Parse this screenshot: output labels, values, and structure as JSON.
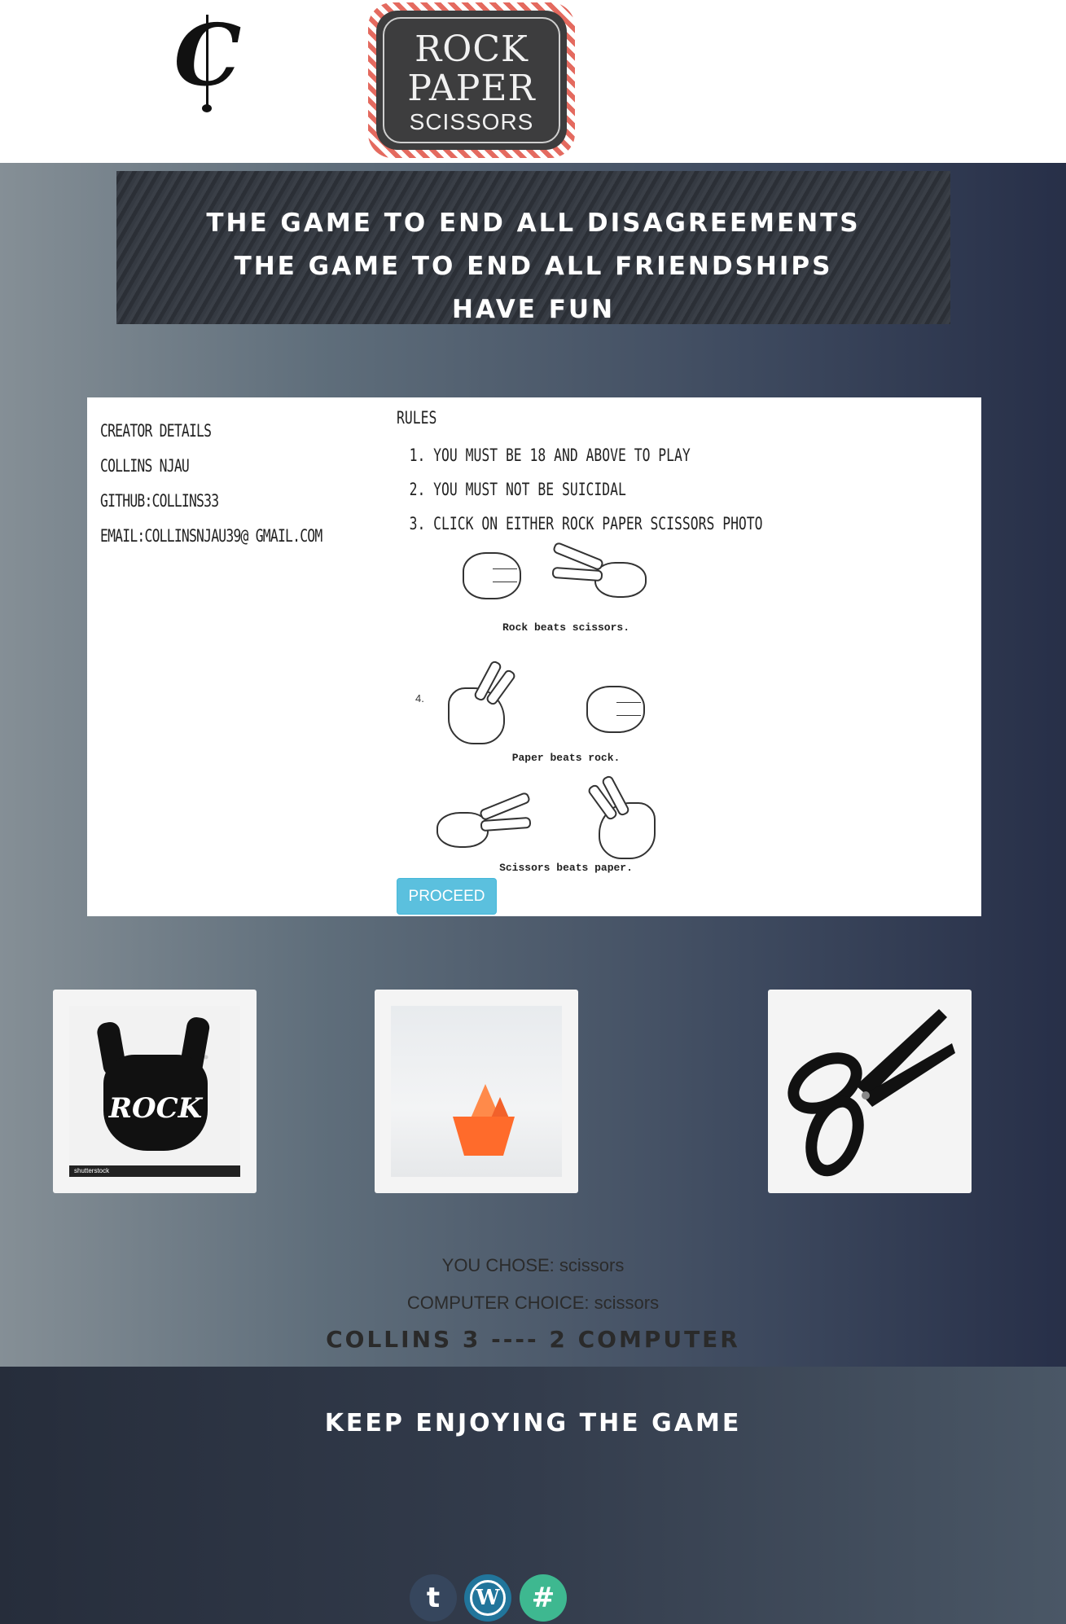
{
  "header": {
    "logo_c": "C",
    "logo_rps": {
      "word1": "ROCK",
      "word2": "PAPER",
      "word3": "SCISSORS"
    }
  },
  "banner": {
    "lines": [
      "THE GAME TO END ALL DISAGREEMENTS",
      "THE GAME TO END ALL FRIENDSHIPS",
      "HAVE FUN"
    ]
  },
  "creator": {
    "heading": "CREATOR DETAILS",
    "name": "COLLINS NJAU",
    "github": "GITHUB:COLLINS33",
    "email": "EMAIL:COLLINSNJAU39@ GMAIL.COM"
  },
  "rules": {
    "title": "RULES",
    "items": [
      "1. YOU MUST BE 18 AND ABOVE TO PLAY",
      "2. YOU MUST NOT BE SUICIDAL",
      "3. CLICK ON EITHER ROCK PAPER SCISSORS PHOTO"
    ],
    "rule4_number": "4.",
    "captions": [
      "Rock beats scissors.",
      "Paper beats rock.",
      "Scissors beats paper."
    ]
  },
  "proceed_label": "PROCEED",
  "tiles": {
    "rock": {
      "word": "ROCK",
      "brand": "shutterstock"
    }
  },
  "result": {
    "you_chose": "YOU CHOSE: scissors",
    "computer_choice": "COMPUTER CHOICE: scissors",
    "score": "COLLINS 3 ---- 2 COMPUTER"
  },
  "footer": {
    "message": "KEEP ENJOYING THE GAME",
    "social": [
      {
        "icon": "tumblr-icon",
        "glyph": "t",
        "color": "#36465d"
      },
      {
        "icon": "wordpress-icon",
        "glyph": "W",
        "color": "#21759b"
      },
      {
        "icon": "slack-icon",
        "glyph": "#",
        "color": "#3eb890"
      }
    ]
  },
  "colors": {
    "proceed": "#5bc0de",
    "gradient_left": "#858f96",
    "gradient_right": "#272f48",
    "boat": "#ff6b2b"
  }
}
